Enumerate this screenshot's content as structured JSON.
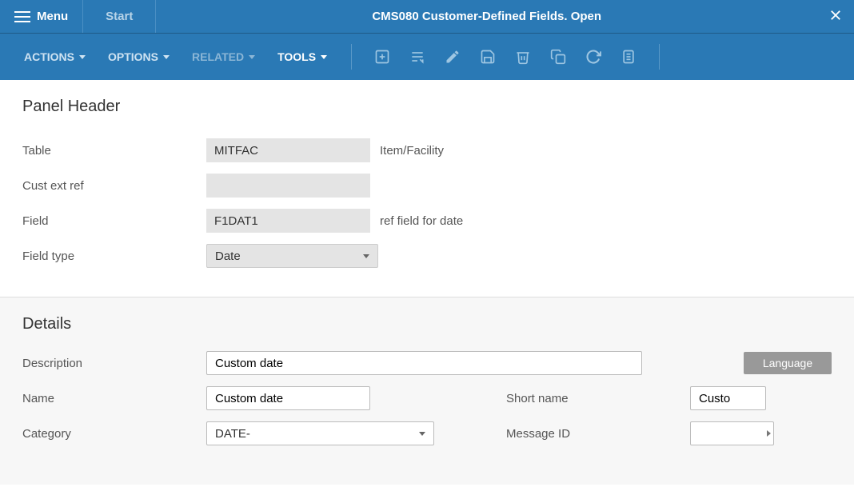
{
  "titlebar": {
    "menu": "Menu",
    "start": "Start",
    "title": "CMS080 Customer-Defined Fields. Open"
  },
  "menubar": {
    "actions": "ACTIONS",
    "options": "OPTIONS",
    "related": "RELATED",
    "tools": "TOOLS"
  },
  "panel": {
    "header": "Panel Header",
    "labels": {
      "table": "Table",
      "cust_ext_ref": "Cust ext ref",
      "field": "Field",
      "field_type": "Field type"
    },
    "values": {
      "table": "MITFAC",
      "table_desc": "Item/Facility",
      "cust_ext_ref": "",
      "field": "F1DAT1",
      "field_desc": "ref field for date",
      "field_type": "Date"
    }
  },
  "details": {
    "header": "Details",
    "labels": {
      "description": "Description",
      "name": "Name",
      "short_name": "Short name",
      "category": "Category",
      "message_id": "Message ID"
    },
    "values": {
      "description": "Custom date",
      "name": "Custom date",
      "short_name": "Custo",
      "category": "DATE-",
      "message_id": ""
    },
    "language_btn": "Language"
  }
}
